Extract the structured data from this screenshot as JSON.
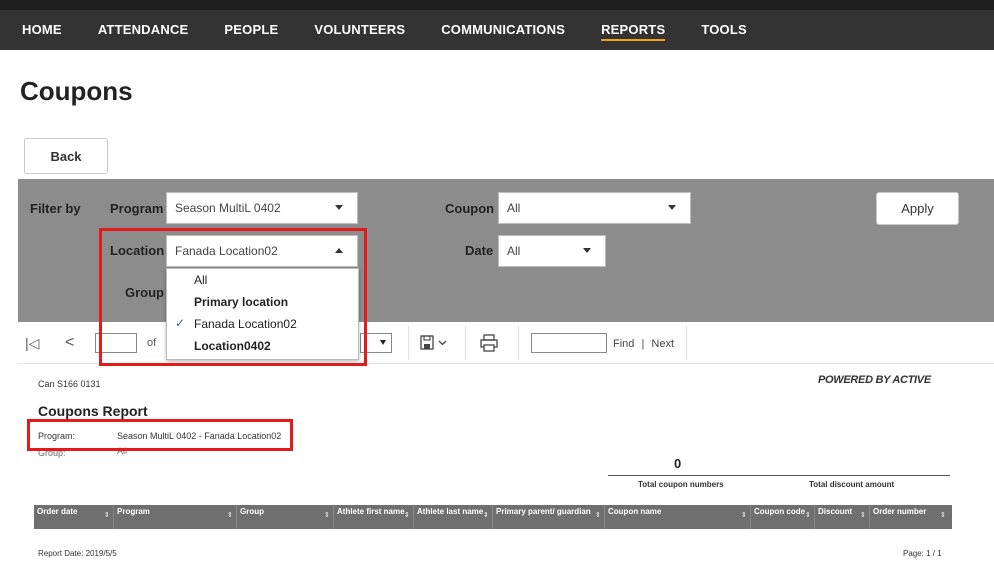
{
  "nav": {
    "items": [
      {
        "label": "HOME",
        "active": false
      },
      {
        "label": "ATTENDANCE",
        "active": false
      },
      {
        "label": "PEOPLE",
        "active": false
      },
      {
        "label": "VOLUNTEERS",
        "active": false
      },
      {
        "label": "COMMUNICATIONS",
        "active": false
      },
      {
        "label": "REPORTS",
        "active": true
      },
      {
        "label": "TOOLS",
        "active": false
      }
    ]
  },
  "page": {
    "title": "Coupons",
    "back_label": "Back"
  },
  "filter": {
    "filter_by_label": "Filter by",
    "program_label": "Program",
    "program_value": "Season MultiL 0402",
    "location_label": "Location",
    "location_value": "Fanada Location02",
    "group_label": "Group",
    "coupon_label": "Coupon",
    "coupon_value": "All",
    "date_label": "Date",
    "date_value": "All",
    "apply_label": "Apply",
    "location_options": [
      {
        "label": "All",
        "bold": false,
        "checked": false
      },
      {
        "label": "Primary location",
        "bold": true,
        "checked": false
      },
      {
        "label": "Fanada Location02",
        "bold": false,
        "checked": true
      },
      {
        "label": "Location0402",
        "bold": true,
        "checked": false
      }
    ]
  },
  "toolbar": {
    "first_icon": "|◁",
    "prev_icon": "<",
    "of_label": "of",
    "save_icon": "save-icon",
    "print_icon": "print-icon",
    "find_label": "Find",
    "separator": "|",
    "next_label": "Next"
  },
  "report": {
    "org_name": "Can S166 0131",
    "powered_by": "POWERED BY ACTIVE",
    "title": "Coupons Report",
    "program_label": "Program:",
    "program_value": "Season MultiL 0402 - Fanada Location02",
    "group_label": "Group:",
    "group_value": "All",
    "total_coupons": "0",
    "total_coupons_label": "Total coupon numbers",
    "total_discount_label": "Total discount amount",
    "columns": [
      "Order date",
      "Program",
      "Group",
      "Athlete first name",
      "Athlete last name",
      "Primary parent/ guardian",
      "Coupon name",
      "Coupon code",
      "Discount",
      "Order number"
    ],
    "report_date": "Report Date: 2019/5/5",
    "page_info": "Page: 1 / 1"
  },
  "colors": {
    "nav_bg": "#333333",
    "active_underline": "#f0a30a",
    "filter_bg": "#8c8c8c",
    "highlight": "#e21b1b"
  }
}
